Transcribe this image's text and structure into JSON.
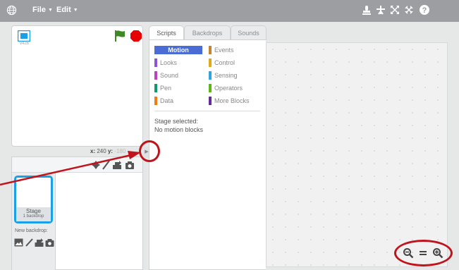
{
  "menubar": {
    "file_label": "File",
    "edit_label": "Edit",
    "tools": [
      "duplicate-icon",
      "cut-icon",
      "grow-icon",
      "shrink-icon",
      "help-icon"
    ]
  },
  "stage": {
    "version": "v426",
    "coords": {
      "x_label": "x:",
      "x_value": "240",
      "y_label": "y:",
      "y_value": "-180"
    }
  },
  "sprites": {
    "stage_name": "Stage",
    "stage_count": "1 backdrop",
    "new_backdrop_label": "New backdrop:"
  },
  "tabs": [
    {
      "label": "Scripts",
      "active": true
    },
    {
      "label": "Backdrops",
      "active": false
    },
    {
      "label": "Sounds",
      "active": false
    }
  ],
  "categories": [
    {
      "label": "Motion",
      "color": "#4a6cd4"
    },
    {
      "label": "Looks",
      "color": "#8a55d7"
    },
    {
      "label": "Sound",
      "color": "#bb42c3"
    },
    {
      "label": "Pen",
      "color": "#0e9a6c"
    },
    {
      "label": "Data",
      "color": "#ee7d16"
    },
    {
      "label": "Events",
      "color": "#c88330"
    },
    {
      "label": "Control",
      "color": "#e1a91a"
    },
    {
      "label": "Sensing",
      "color": "#2ca5e2"
    },
    {
      "label": "Operators",
      "color": "#5cb712"
    },
    {
      "label": "More Blocks",
      "color": "#632d99"
    }
  ],
  "scripts": {
    "selected_line1": "Stage selected:",
    "selected_line2": "No motion blocks"
  },
  "colors": {
    "annotation": "#c0141c",
    "selection": "#1aa0e6",
    "stop": "#e60000",
    "flag": "#3d8a24"
  }
}
